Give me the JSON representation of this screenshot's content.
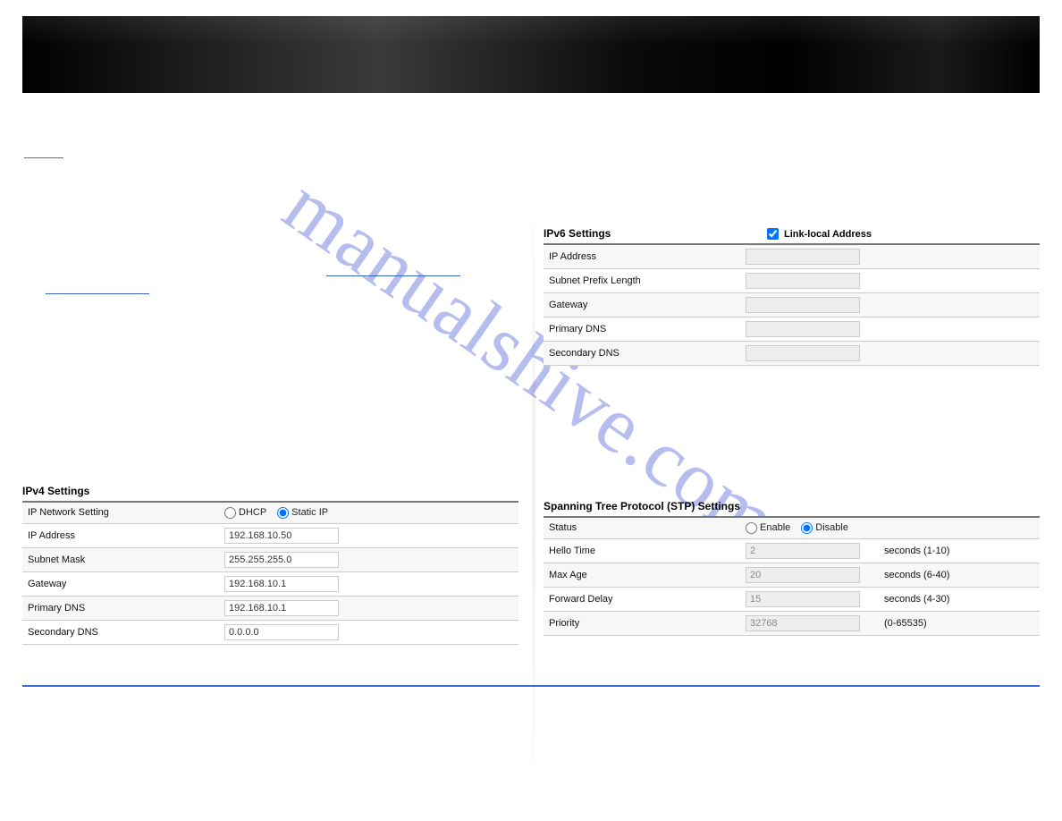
{
  "watermark_text": "manualshive.com",
  "ipv4": {
    "title": "IPv4 Settings",
    "network_setting_label": "IP Network Setting",
    "dhcp_label": "DHCP",
    "static_label": "Static IP",
    "dhcp_selected": false,
    "static_selected": true,
    "rows": {
      "ip_address_label": "IP Address",
      "ip_address_value": "192.168.10.50",
      "subnet_mask_label": "Subnet Mask",
      "subnet_mask_value": "255.255.255.0",
      "gateway_label": "Gateway",
      "gateway_value": "192.168.10.1",
      "primary_dns_label": "Primary DNS",
      "primary_dns_value": "192.168.10.1",
      "secondary_dns_label": "Secondary DNS",
      "secondary_dns_value": "0.0.0.0"
    }
  },
  "ipv6": {
    "title": "IPv6 Settings",
    "link_local_checked": true,
    "link_local_label": "Link-local Address",
    "rows": {
      "ip_address_label": "IP Address",
      "ip_address_value": "",
      "prefix_label": "Subnet Prefix Length",
      "prefix_value": "",
      "gateway_label": "Gateway",
      "gateway_value": "",
      "primary_dns_label": "Primary DNS",
      "primary_dns_value": "",
      "secondary_dns_label": "Secondary DNS",
      "secondary_dns_value": ""
    }
  },
  "stp": {
    "title": "Spanning Tree Protocol (STP) Settings",
    "status_label": "Status",
    "enable_label": "Enable",
    "disable_label": "Disable",
    "enable_selected": false,
    "disable_selected": true,
    "rows": {
      "hello_label": "Hello Time",
      "hello_value": "2",
      "hello_hint": "seconds (1-10)",
      "maxage_label": "Max Age",
      "maxage_value": "20",
      "maxage_hint": "seconds (6-40)",
      "fwd_label": "Forward Delay",
      "fwd_value": "15",
      "fwd_hint": "seconds (4-30)",
      "priority_label": "Priority",
      "priority_value": "32768",
      "priority_hint": "(0-65535)"
    }
  }
}
